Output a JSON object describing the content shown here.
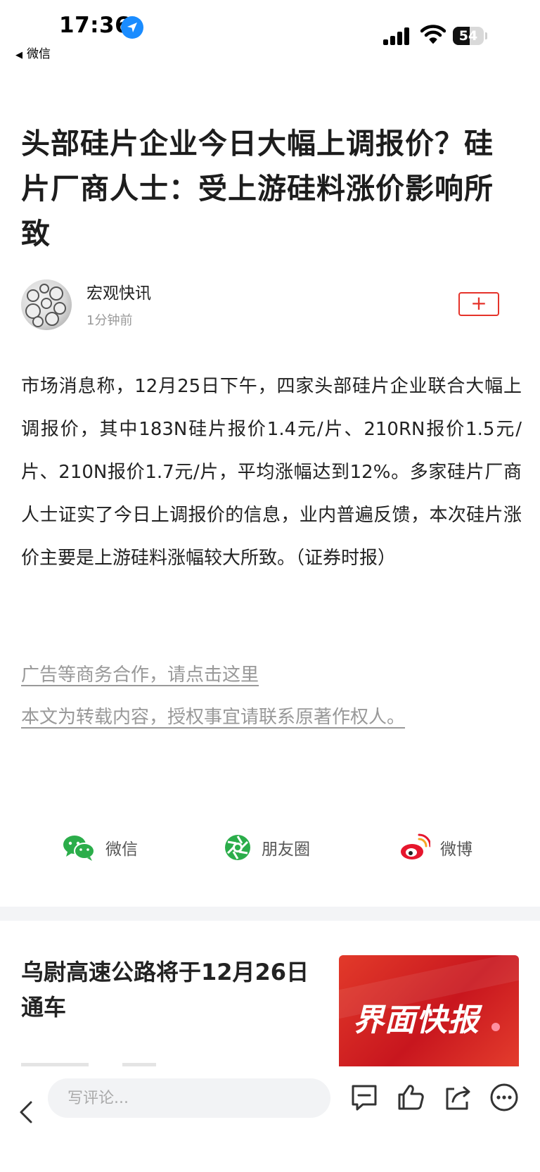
{
  "status_bar": {
    "time": "17:36",
    "back_app": "微信",
    "battery": "54",
    "battery_level": 0.54
  },
  "article": {
    "title": "头部硅片企业今日大幅上调报价？硅片厂商人士：受上游硅料涨价影响所致",
    "author": "宏观快讯",
    "time": "1分钟前",
    "follow_icon": "+",
    "body": "市场消息称，12月25日下午，四家头部硅片企业联合大幅上调报价，其中183N硅片报价1.4元/片、210RN报价1.5元/片、210N报价1.7元/片，平均涨幅达到12%。多家硅片厂商人士证实了今日上调报价的信息，业内普遍反馈，本次硅片涨价主要是上游硅料涨幅较大所致。（证券时报）",
    "ad_link": "广告等商务合作，请点击这里",
    "copyright_link": "本文为转载内容，授权事宜请联系原著作权人。"
  },
  "share": {
    "wechat": "微信",
    "moments": "朋友圈",
    "weibo": "微博"
  },
  "recommend": {
    "title": "乌尉高速公路将于12月26日通车",
    "thumb_text": "界面快报"
  },
  "bottom_bar": {
    "comment_placeholder": "写评论..."
  },
  "colors": {
    "accent_red": "#e5332a",
    "wechat_green": "#2bad4a",
    "weibo_red": "#e6162d"
  }
}
